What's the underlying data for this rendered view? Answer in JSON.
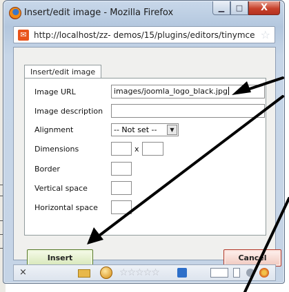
{
  "window": {
    "title": "Insert/edit image - Mozilla Firefox",
    "minimize_glyph": "▁",
    "maximize_glyph": "□",
    "close_glyph": "X"
  },
  "address_bar": {
    "url": "http://localhost/zz- demos/15/plugins/editors/tinymce",
    "site_icon_glyph": "✉",
    "bookmark_glyph": "☆"
  },
  "dialog": {
    "tab_label": "Insert/edit image",
    "fields": {
      "image_url_label": "Image URL",
      "image_url_value": "images/joomla_logo_black.jpg",
      "image_description_label": "Image description",
      "image_description_value": "",
      "alignment_label": "Alignment",
      "alignment_value": "-- Not set --",
      "dimensions_label": "Dimensions",
      "dimensions_separator": "x",
      "width_value": "",
      "height_value": "",
      "border_label": "Border",
      "border_value": "",
      "vertical_space_label": "Vertical space",
      "vertical_space_value": "",
      "horizontal_space_label": "Horizontal space",
      "horizontal_space_value": ""
    },
    "insert_label": "Insert",
    "cancel_label": "Cancel"
  },
  "status_bar": {
    "close_glyph": "×",
    "stars_glyph": "☆☆☆☆☆"
  },
  "colors": {
    "annotation_arrow": "#000000",
    "insert_button_border": "#587a2a",
    "cancel_button_border": "#b23a2a"
  },
  "icons": [
    "firefox-icon",
    "site-favicon-icon",
    "bookmark-star-icon",
    "minimize-icon",
    "maximize-icon",
    "close-icon",
    "dropdown-arrow-icon",
    "folder-icon",
    "flash-icon",
    "rating-stars-icon"
  ]
}
